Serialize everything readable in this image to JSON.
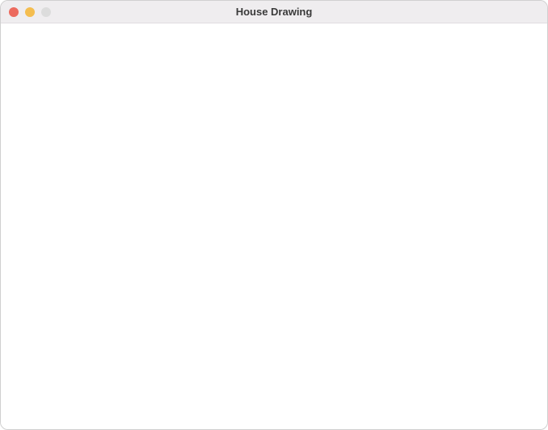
{
  "window": {
    "title": "House Drawing"
  }
}
